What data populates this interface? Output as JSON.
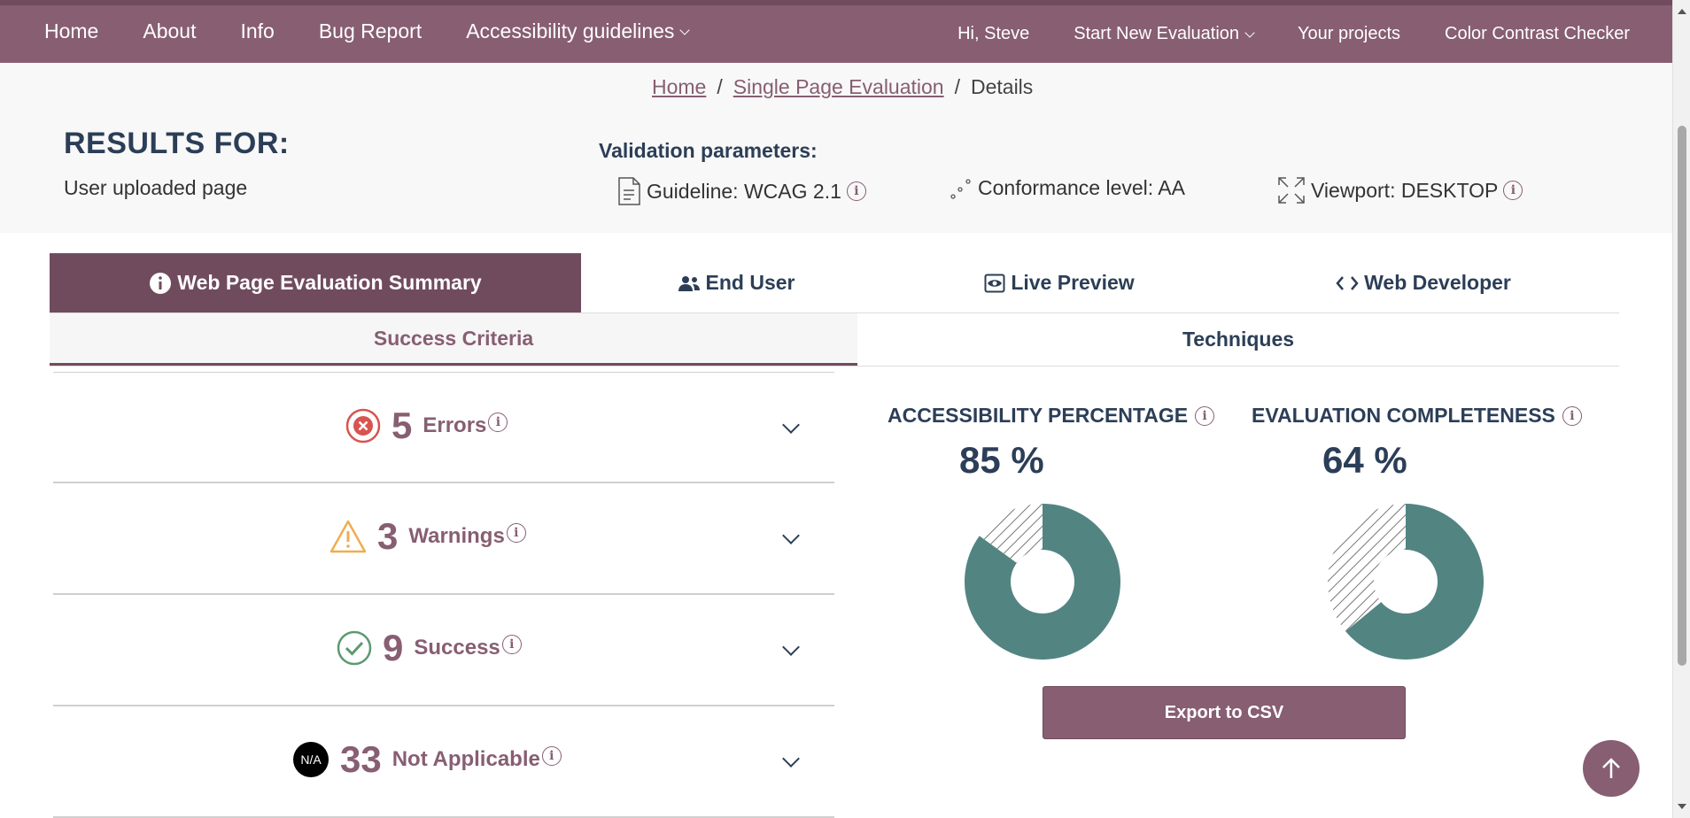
{
  "nav": {
    "left": [
      "Home",
      "About",
      "Info",
      "Bug Report",
      "Accessibility guidelines"
    ],
    "right": [
      "Hi, Steve",
      "Start New Evaluation",
      "Your projects",
      "Color Contrast Checker"
    ]
  },
  "breadcrumb": {
    "home": "Home",
    "single": "Single Page Evaluation",
    "sep": "/",
    "current": "Details"
  },
  "results": {
    "title": "RESULTS FOR:",
    "subtitle": "User uploaded page"
  },
  "validation": {
    "title": "Validation parameters:",
    "guideline": "Guideline: WCAG 2.1",
    "conformance": "Conformance level: AA",
    "viewport": "Viewport: DESKTOP"
  },
  "tabs": [
    "Web Page Evaluation Summary",
    "End User",
    "Live Preview",
    "Web Developer"
  ],
  "subtabs": [
    "Success Criteria",
    "Techniques"
  ],
  "criteria": [
    {
      "count": "5",
      "label": "Errors"
    },
    {
      "count": "3",
      "label": "Warnings"
    },
    {
      "count": "9",
      "label": "Success"
    },
    {
      "count": "33",
      "label": "Not Applicable",
      "badge": "N/A"
    }
  ],
  "gauges": {
    "accessibility": {
      "title": "ACCESSIBILITY PERCENTAGE",
      "display": "85 %",
      "percent": 85
    },
    "completeness": {
      "title": "EVALUATION COMPLETENESS",
      "display": "64 %",
      "percent": 64
    }
  },
  "export_label": "Export to CSV",
  "colors": {
    "brand": "#875e72",
    "brand_dark": "#704b5e",
    "donut_fill": "#528482",
    "error": "#d9534f",
    "warning": "#f0ad4e",
    "success": "#5a9a6e"
  },
  "icons": {
    "errors": "x-circle-icon",
    "warnings": "warning-triangle-icon",
    "success": "check-circle-icon",
    "not_applicable": "na-badge-icon",
    "guideline": "document-icon",
    "conformance": "dots-icon",
    "viewport": "expand-icon",
    "to_top": "arrow-up-icon"
  }
}
